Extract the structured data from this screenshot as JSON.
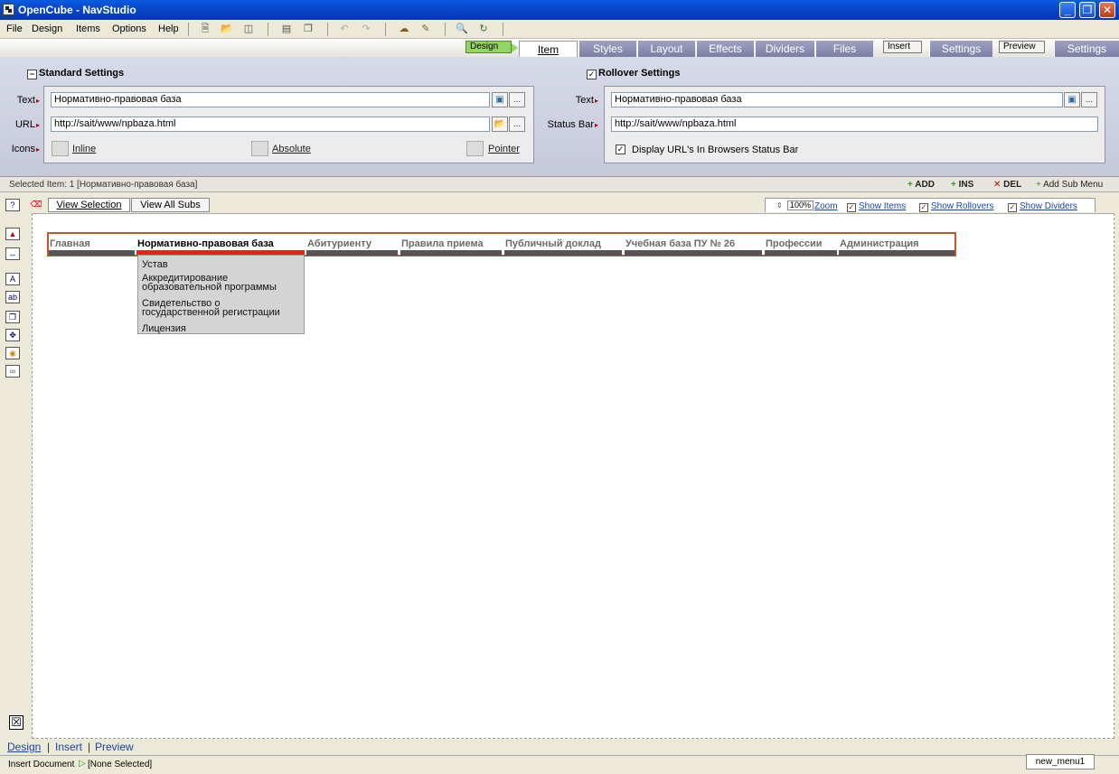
{
  "window": {
    "title": "OpenCube - NavStudio"
  },
  "menubar": {
    "items": [
      "File",
      "Design",
      "Items",
      "Options",
      "Help"
    ]
  },
  "tabs": {
    "design_label": "Design",
    "design_tabs": [
      "Item",
      "Styles",
      "Layout",
      "Effects",
      "Dividers",
      "Files"
    ],
    "insert_label": "Insert",
    "insert_tabs": [
      "Settings"
    ],
    "preview_label": "Preview",
    "preview_tabs": [
      "Settings"
    ]
  },
  "standard": {
    "heading": "Standard Settings",
    "text_label": "Text",
    "text_value": "Нормативно-правовая база",
    "url_label": "URL",
    "url_value": "http://sait/www/npbaza.html",
    "icons_label": "Icons",
    "icon_options": [
      "Inline",
      "Absolute",
      "Pointer"
    ]
  },
  "rollover": {
    "heading": "Rollover Settings",
    "text_label": "Text",
    "text_value": "Нормативно-правовая база",
    "status_label": "Status Bar",
    "status_value": "http://sait/www/npbaza.html",
    "display_label": "Display URL's In Browsers Status Bar"
  },
  "selection": {
    "text": "Selected Item: 1  [Нормативно-правовая база]",
    "add": "ADD",
    "ins": "INS",
    "del": "DEL",
    "addsub": "Add Sub Menu"
  },
  "view": {
    "tabs": [
      "View Selection",
      "View All Subs"
    ],
    "zoom_value": "100%",
    "zoom_label": "Zoom",
    "options": [
      "Show Items",
      "Show Rollovers",
      "Show Dividers"
    ]
  },
  "nav_menu": {
    "items": [
      "Главная",
      "Нормативно-правовая база",
      "Абитуриенту",
      "Правила приема",
      "Публичный доклад",
      "Учебная база ПУ № 26",
      "Профессии",
      "Администрация"
    ],
    "selected_index": 1,
    "submenu": [
      "Устав",
      "Аккредитирование образовательной программы",
      "Свидетельство о государственной регистрации",
      "Лицензия"
    ]
  },
  "bottom": {
    "nav": [
      "Design",
      "Insert",
      "Preview"
    ],
    "status": "Insert Document",
    "status_value": "[None Selected]",
    "doc_tab": "new_menu1"
  }
}
